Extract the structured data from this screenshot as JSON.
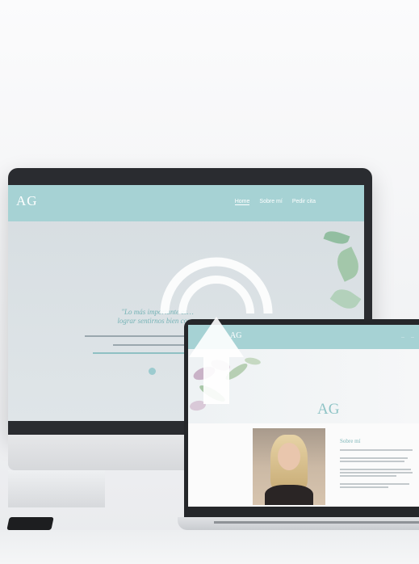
{
  "desktop_site": {
    "logo": "AG",
    "nav": [
      "Home",
      "Sobre mí",
      "Pedir cita"
    ],
    "quote_line1": "\"Lo más importante es…",
    "quote_line2": "lograr sentirnos bien con…"
  },
  "laptop_site": {
    "logo": "AG",
    "hero_logo": "AG",
    "section_title": "Sobre mí"
  },
  "overlay": {
    "icon": "upload-broadcast-icon"
  },
  "colors": {
    "accent": "#a6d2d4",
    "accent_text": "#76b3b6",
    "device_frame": "#2a2c30"
  }
}
